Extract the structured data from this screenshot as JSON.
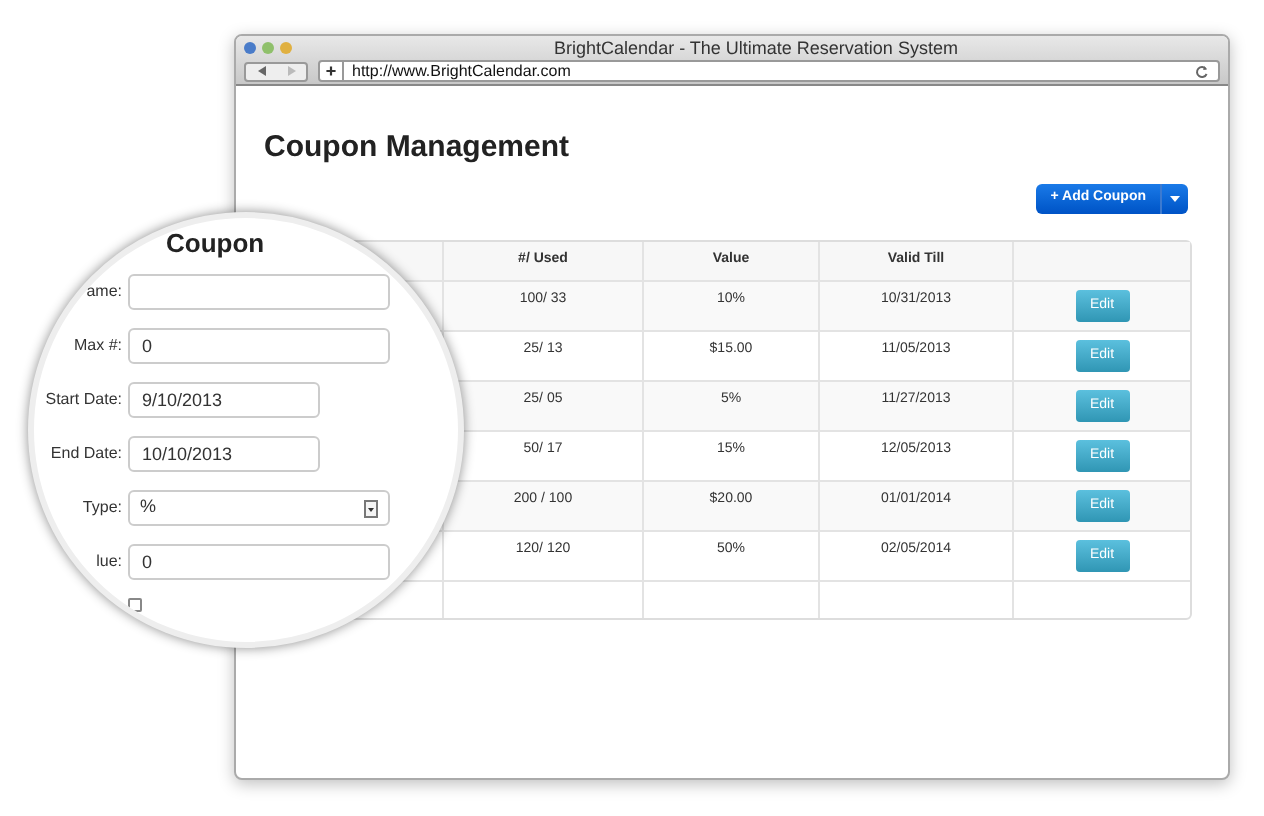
{
  "window": {
    "title": "BrightCalendar - The Ultimate Reservation System",
    "url": "http://www.BrightCalendar.com"
  },
  "page": {
    "title": "Coupon Management",
    "add_button": "+ Add Coupon"
  },
  "table": {
    "columns": [
      "#/ Used",
      "Value",
      "Valid Till"
    ],
    "rows": [
      {
        "used": "100/ 33",
        "value": "10%",
        "valid_till": "10/31/2013",
        "action": "Edit"
      },
      {
        "used": "25/ 13",
        "value": "$15.00",
        "valid_till": "11/05/2013",
        "action": "Edit"
      },
      {
        "used": "25/ 05",
        "value": "5%",
        "valid_till": "11/27/2013",
        "action": "Edit"
      },
      {
        "used": "50/ 17",
        "value": "15%",
        "valid_till": "12/05/2013",
        "action": "Edit"
      },
      {
        "used": "200 / 100",
        "value": "$20.00",
        "valid_till": "01/01/2014",
        "action": "Edit"
      },
      {
        "used": "120/ 120",
        "value": "50%",
        "valid_till": "02/05/2014",
        "action": "Edit"
      }
    ]
  },
  "magnifier": {
    "title": "Coupon",
    "fields": [
      {
        "kind": "text",
        "label": "ame:"
      },
      {
        "kind": "text",
        "label": "Max #:",
        "value": "0"
      },
      {
        "kind": "date",
        "label": "Start Date:",
        "value": "9/10/2013"
      },
      {
        "kind": "date",
        "label": "End Date:",
        "value": "10/10/2013"
      },
      {
        "kind": "select",
        "label": "Type:",
        "value": "%"
      },
      {
        "kind": "text",
        "label": "lue:",
        "value": "0"
      }
    ],
    "checkbox": {
      "checked": false
    }
  }
}
